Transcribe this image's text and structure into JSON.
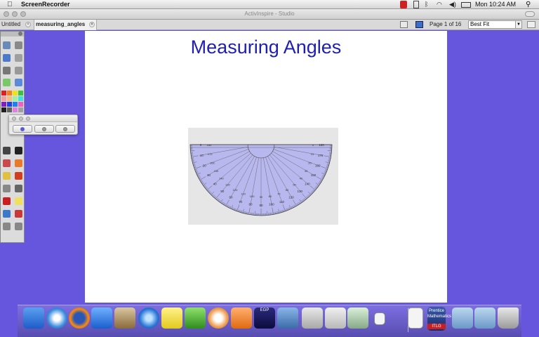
{
  "menubar": {
    "apple_glyph": "",
    "app_name": "ScreenRecorder",
    "clock": "Mon 10:24 AM",
    "spotlight_glyph": "🔍"
  },
  "window": {
    "title": "ActivInspire - Studio"
  },
  "tabs": [
    {
      "label": "Untitled"
    },
    {
      "label": "measuring_angles"
    }
  ],
  "pager": {
    "page_text": "Page 1 of 16",
    "zoom_value": "Best Fit"
  },
  "slide": {
    "title": "Measuring Angles"
  },
  "protractor": {
    "outer_labels": [
      "0",
      "10",
      "20",
      "30",
      "40",
      "50",
      "60",
      "70",
      "80",
      "90",
      "100",
      "110",
      "120",
      "130",
      "140",
      "150",
      "160",
      "170",
      "180"
    ],
    "inner_labels": [
      "180",
      "170",
      "160",
      "150",
      "140",
      "130",
      "120",
      "110",
      "100",
      "90",
      "80",
      "70",
      "60",
      "50",
      "40",
      "30",
      "20",
      "10",
      "0"
    ]
  },
  "dock": {
    "egp_label": "EGP",
    "itlg_label": "ITLG",
    "prentice_label": "Prentice Mathematics"
  },
  "colors": {
    "desktop": "#6655dd",
    "slide_title": "#2020b0",
    "protractor_fill": "#b8b8ee"
  }
}
